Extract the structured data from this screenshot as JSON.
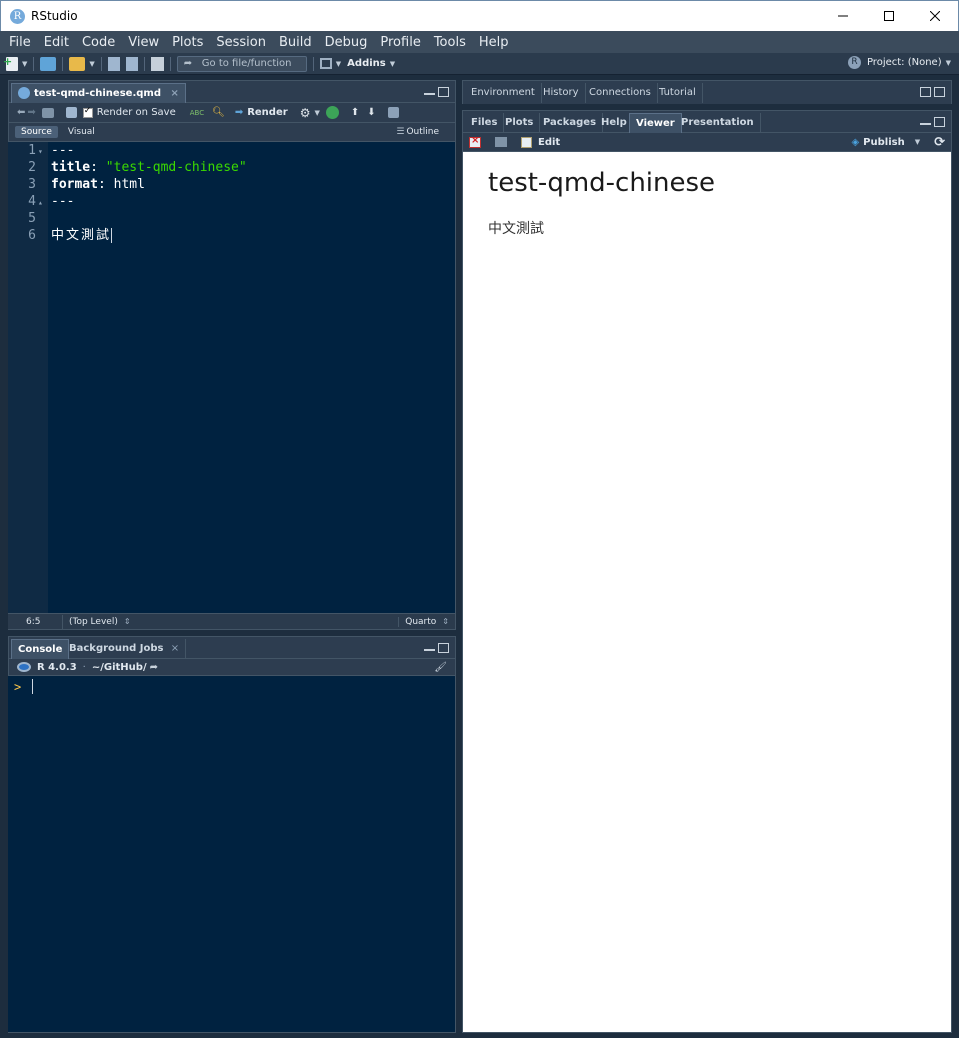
{
  "window": {
    "title": "RStudio",
    "logo_letter": "R"
  },
  "menu": [
    "File",
    "Edit",
    "Code",
    "View",
    "Plots",
    "Session",
    "Build",
    "Debug",
    "Profile",
    "Tools",
    "Help"
  ],
  "toolbar": {
    "goto_placeholder": "Go to file/function",
    "addins_label": "Addins",
    "project_label": "Project: (None)"
  },
  "source_pane": {
    "tab_label": "test-qmd-chinese.qmd",
    "render_on_save_label": "Render on Save",
    "render_on_save_checked": true,
    "render_label": "Render",
    "mode_tabs": [
      "Source",
      "Visual"
    ],
    "active_mode": "Source",
    "outline_label": "Outline",
    "lines": [
      {
        "num": "1",
        "text": "---"
      },
      {
        "num": "2",
        "key": "title",
        "value": "\"test-qmd-chinese\""
      },
      {
        "num": "3",
        "key": "format",
        "value": "html"
      },
      {
        "num": "4",
        "text": "---"
      },
      {
        "num": "5",
        "text": ""
      },
      {
        "num": "6",
        "text": "中文測試"
      }
    ],
    "status": {
      "position": "6:5",
      "scope": "(Top Level)",
      "file_type": "Quarto"
    }
  },
  "console_pane": {
    "tabs": [
      "Console",
      "Background Jobs"
    ],
    "active_tab": "Console",
    "r_version": "R 4.0.3",
    "working_dir": "~/GitHub/",
    "prompt": ">"
  },
  "env_pane": {
    "tabs": [
      "Environment",
      "History",
      "Connections",
      "Tutorial"
    ]
  },
  "files_pane": {
    "tabs": [
      "Files",
      "Plots",
      "Packages",
      "Help",
      "Viewer",
      "Presentation"
    ],
    "active_tab": "Viewer",
    "edit_label": "Edit",
    "publish_label": "Publish"
  },
  "viewer": {
    "heading": "test-qmd-chinese",
    "body": "中文測試"
  }
}
